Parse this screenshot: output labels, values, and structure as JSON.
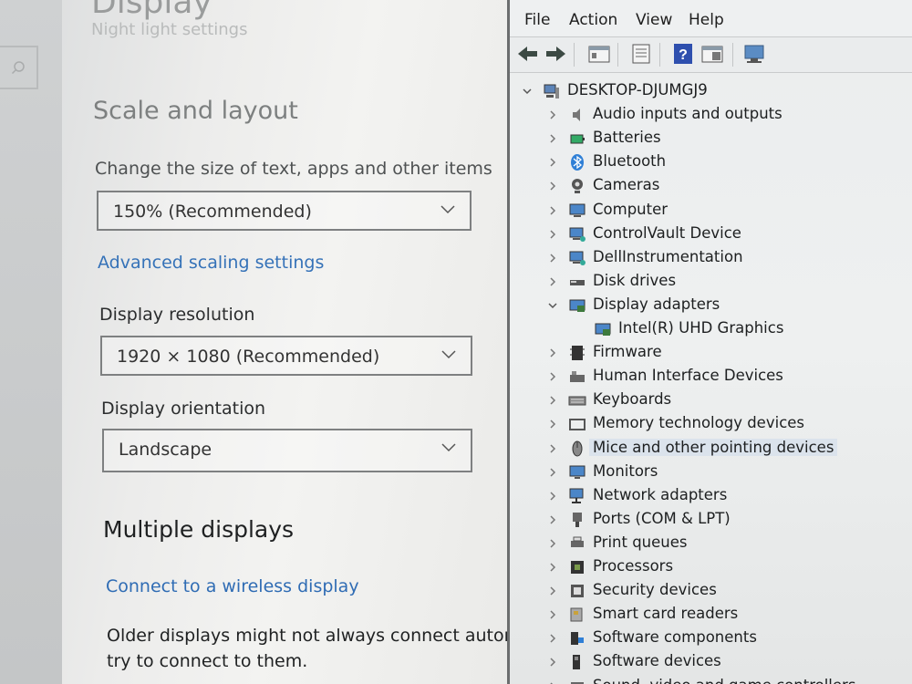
{
  "settings": {
    "page_title": "Display",
    "subtitle_ghost": "Night light settings",
    "scale_section": {
      "heading": "Scale and layout",
      "scale_label": "Change the size of text, apps and other items",
      "scale_value": "150% (Recommended)",
      "advanced_link": "Advanced scaling settings",
      "resolution_label": "Display resolution",
      "resolution_value": "1920 × 1080 (Recommended)",
      "orientation_label": "Display orientation",
      "orientation_value": "Landscape"
    },
    "multiple_section": {
      "heading": "Multiple displays",
      "wireless_link": "Connect to a wireless display",
      "older_text_line1": "Older displays might not always connect automati",
      "older_text_line2": "try to connect to them."
    }
  },
  "device_manager": {
    "menu": [
      "File",
      "Action",
      "View",
      "Help"
    ],
    "toolbar_icons": [
      "back-arrow-icon",
      "forward-arrow-icon",
      "properties-icon",
      "list-icon",
      "help-icon",
      "view-icon",
      "monitor-scan-icon"
    ],
    "root": "DESKTOP-DJUMGJ9",
    "categories": [
      {
        "label": "Audio inputs and outputs",
        "icon": "speaker-icon",
        "expanded": false
      },
      {
        "label": "Batteries",
        "icon": "battery-icon",
        "expanded": false
      },
      {
        "label": "Bluetooth",
        "icon": "bluetooth-icon",
        "expanded": false
      },
      {
        "label": "Cameras",
        "icon": "camera-icon",
        "expanded": false
      },
      {
        "label": "Computer",
        "icon": "computer-icon",
        "expanded": false
      },
      {
        "label": "ControlVault Device",
        "icon": "device-icon",
        "expanded": false
      },
      {
        "label": "DellInstrumentation",
        "icon": "device-icon",
        "expanded": false
      },
      {
        "label": "Disk drives",
        "icon": "disk-icon",
        "expanded": false
      },
      {
        "label": "Display adapters",
        "icon": "display-adapter-icon",
        "expanded": true,
        "children": [
          "Intel(R) UHD Graphics"
        ]
      },
      {
        "label": "Firmware",
        "icon": "firmware-icon",
        "expanded": false
      },
      {
        "label": "Human Interface Devices",
        "icon": "hid-icon",
        "expanded": false
      },
      {
        "label": "Keyboards",
        "icon": "keyboard-icon",
        "expanded": false
      },
      {
        "label": "Memory technology devices",
        "icon": "memory-icon",
        "expanded": false
      },
      {
        "label": "Mice and other pointing devices",
        "icon": "mouse-icon",
        "expanded": false,
        "selected": true
      },
      {
        "label": "Monitors",
        "icon": "monitor-icon",
        "expanded": false
      },
      {
        "label": "Network adapters",
        "icon": "network-icon",
        "expanded": false
      },
      {
        "label": "Ports (COM & LPT)",
        "icon": "port-icon",
        "expanded": false
      },
      {
        "label": "Print queues",
        "icon": "printer-icon",
        "expanded": false
      },
      {
        "label": "Processors",
        "icon": "processor-icon",
        "expanded": false
      },
      {
        "label": "Security devices",
        "icon": "security-icon",
        "expanded": false
      },
      {
        "label": "Smart card readers",
        "icon": "smartcard-icon",
        "expanded": false
      },
      {
        "label": "Software components",
        "icon": "software-icon",
        "expanded": false
      },
      {
        "label": "Software devices",
        "icon": "software-device-icon",
        "expanded": false
      },
      {
        "label": "Sound, video and game controllers",
        "icon": "sound-icon",
        "expanded": false
      }
    ]
  },
  "colors": {
    "link": "#3572b8",
    "selection": "#dbe3ec",
    "accent_blue": "#2f7fd6"
  }
}
